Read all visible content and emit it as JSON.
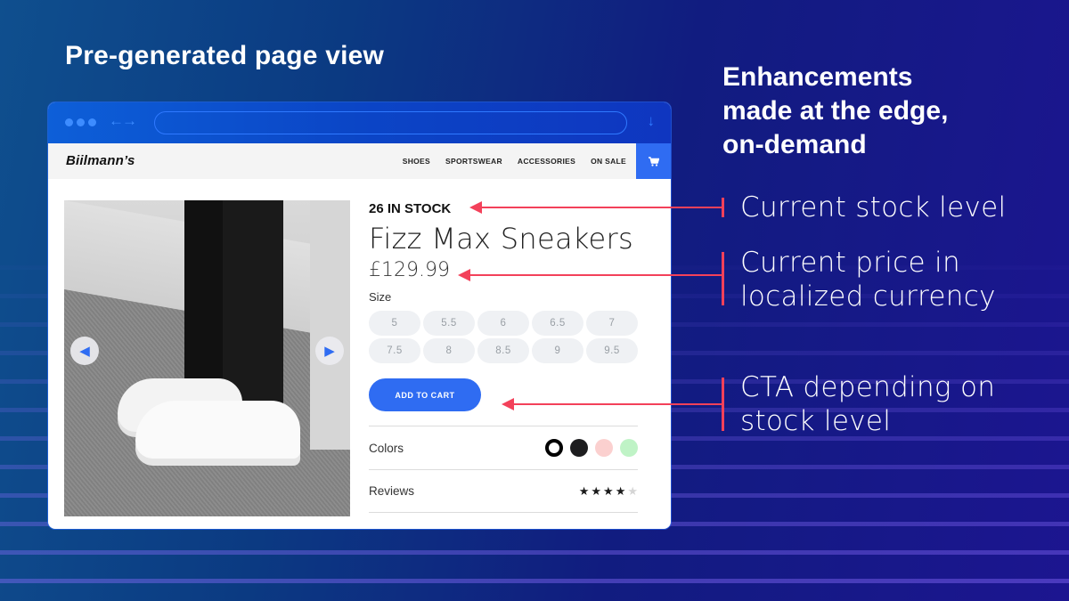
{
  "slide": {
    "left_title": "Pre-generated page view",
    "right_title_lines": [
      "Enhancements",
      "made at the edge,",
      "on-demand"
    ]
  },
  "browser": {
    "address_bar_value": "",
    "icons": {
      "window_controls": "traffic-dots-icon",
      "nav": "back-forward-arrows-icon",
      "download": "download-arrow-icon"
    }
  },
  "site": {
    "logo": "Biilmann’s",
    "nav": [
      "SHOES",
      "SPORTSWEAR",
      "ACCESSORIES",
      "ON SALE"
    ],
    "cart_icon": "cart-icon"
  },
  "product": {
    "stock": "26 IN STOCK",
    "name": "Fizz Max Sneakers",
    "price": "£129.99",
    "size_label": "Size",
    "sizes": [
      "5",
      "5.5",
      "6",
      "6.5",
      "7",
      "7.5",
      "8",
      "8.5",
      "9",
      "9.5"
    ],
    "cta": "ADD TO CART",
    "colors_label": "Colors",
    "colors": [
      "#ffffff",
      "#1d1d1f",
      "#fbd0cf",
      "#bff3c6"
    ],
    "selected_color_index": 0,
    "reviews_label": "Reviews",
    "rating": 4,
    "rating_max": 5,
    "gallery_prev_icon": "triangle-left-icon",
    "gallery_next_icon": "triangle-right-icon"
  },
  "callouts": [
    {
      "lines": [
        "Current stock level"
      ]
    },
    {
      "lines": [
        "Current price in",
        "localized currency"
      ]
    },
    {
      "lines": [
        "CTA depending on",
        "stock level"
      ]
    }
  ],
  "colors": {
    "accent_blue": "#2f6cf2",
    "annotation_red": "#f3415a"
  }
}
